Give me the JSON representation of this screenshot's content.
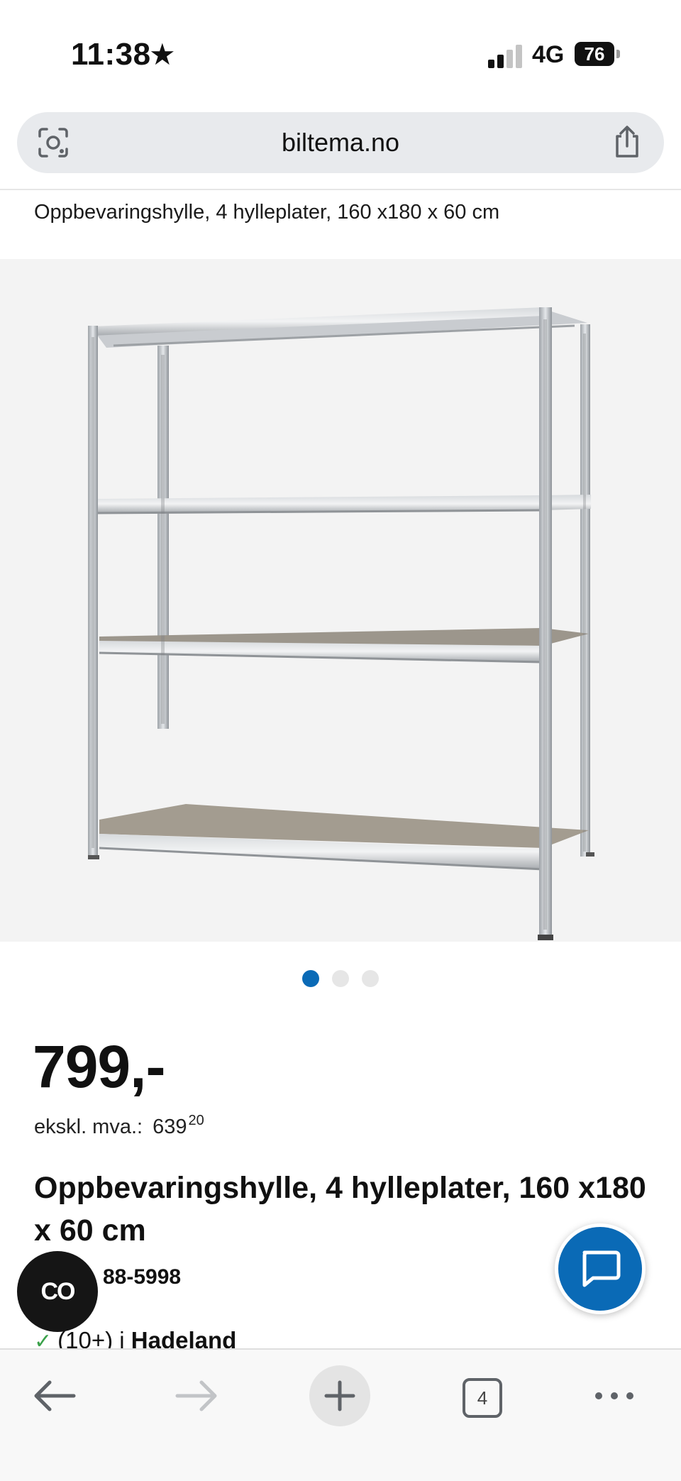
{
  "status_bar": {
    "time": "11:38",
    "star": "★",
    "network": "4G",
    "battery": "76"
  },
  "browser": {
    "url": "biltema.no",
    "tabs_count": "4"
  },
  "page": {
    "breadcrumb_title": "Oppbevaringshylle, 4 hylleplater, 160 x180 x 60 cm",
    "image_dots_count": 3,
    "image_dots_active_index": 0,
    "price": "799,-",
    "price_ex_vat_label": "ekskl. mva.:",
    "price_ex_vat_main": "639",
    "price_ex_vat_decimals": "20",
    "product_title": "Oppbevaringshylle, 4 hylleplater, 160 x180 x 60 cm",
    "article_number_partial": "88-5998",
    "stock_check": "✓",
    "stock_count": "(10+) i ",
    "stock_location": "Hadeland"
  },
  "floating": {
    "co_label": "CO"
  },
  "colors": {
    "accent_blue": "#0a6ab6",
    "stock_green": "#3aa14a"
  },
  "icons": [
    "lens-icon",
    "share-icon",
    "chat-icon",
    "back-arrow-icon",
    "forward-arrow-icon",
    "plus-icon",
    "tabs-icon",
    "more-icon"
  ]
}
